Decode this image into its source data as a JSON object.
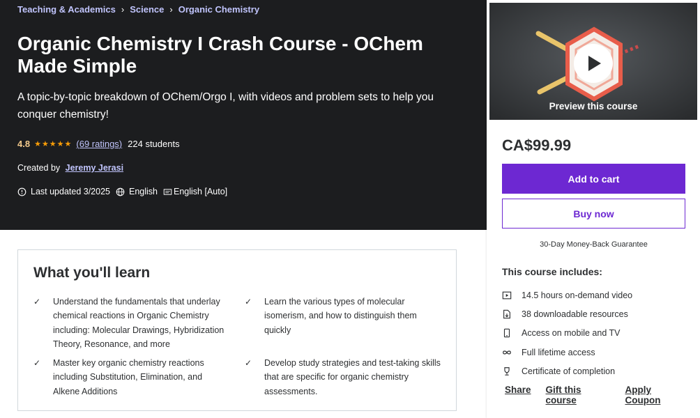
{
  "breadcrumb": [
    "Teaching & Academics",
    "Science",
    "Organic Chemistry"
  ],
  "course": {
    "title": "Organic Chemistry I Crash Course - OChem Made Simple",
    "subtitle": "A topic-by-topic breakdown of OChem/Orgo I, with videos and problem sets to help you conquer chemistry!",
    "rating": "4.8",
    "stars": "★★★★★",
    "ratings_link": "(69 ratings)",
    "students": "224 students",
    "created_label": "Created by",
    "author": "Jeremy Jerasi",
    "last_updated": "Last updated 3/2025",
    "language": "English",
    "captions": "English [Auto]"
  },
  "sidebar": {
    "preview_label": "Preview this course",
    "price": "CA$99.99",
    "add_to_cart": "Add to cart",
    "buy_now": "Buy now",
    "guarantee": "30-Day Money-Back Guarantee",
    "includes_title": "This course includes:",
    "includes": [
      {
        "icon": "video-icon",
        "text": "14.5 hours on-demand video"
      },
      {
        "icon": "file-download-icon",
        "text": "38 downloadable resources"
      },
      {
        "icon": "mobile-icon",
        "text": "Access on mobile and TV"
      },
      {
        "icon": "infinity-icon",
        "text": "Full lifetime access"
      },
      {
        "icon": "trophy-icon",
        "text": "Certificate of completion"
      }
    ],
    "actions": [
      "Share",
      "Gift this course",
      "Apply Coupon"
    ]
  },
  "learn": {
    "title": "What you'll learn",
    "items": [
      "Understand the fundamentals that underlay chemical reactions in Organic Chemistry including: Molecular Drawings, Hybridization Theory, Resonance, and more",
      "Learn the various types of molecular isomerism, and how to distinguish them quickly",
      "Master key organic chemistry reactions including Substitution, Elimination, and Alkene Additions",
      "Develop study strategies and test-taking skills that are specific for organic chemistry assessments."
    ]
  },
  "colors": {
    "hero_bg": "#1c1d1f",
    "link": "#c0c4fc",
    "accent": "#6d28d2",
    "rating": "#f3ca8c",
    "stars": "#f69c08"
  }
}
